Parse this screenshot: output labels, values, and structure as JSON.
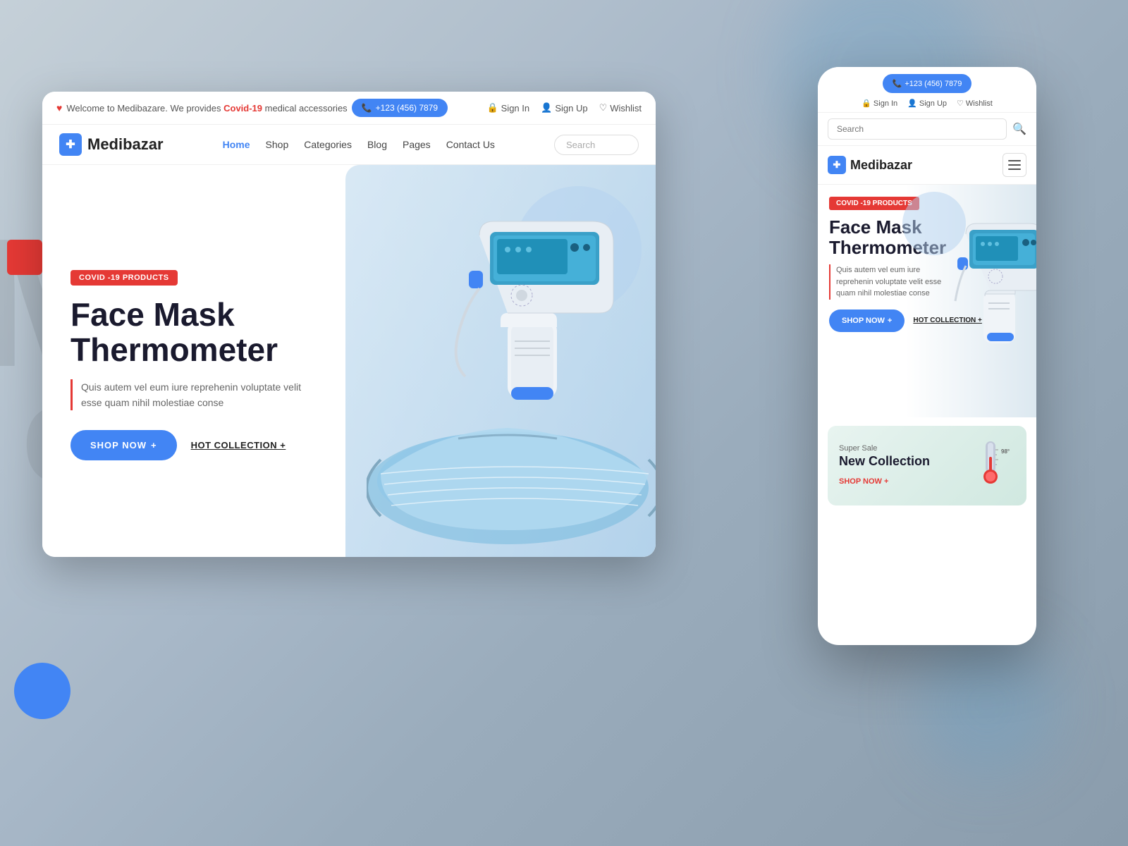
{
  "background": {
    "color": "#b0bec5"
  },
  "topbar": {
    "welcome_text": "Welcome to Medibazare. We provides ",
    "covid_link": "Covid-19",
    "welcome_suffix": " medical accessories",
    "phone": "+123 (456) 7879",
    "sign_in": "Sign In",
    "sign_up": "Sign Up",
    "wishlist": "Wishlist"
  },
  "navbar": {
    "logo_text": "Medibazar",
    "logo_icon": "✚",
    "links": [
      "Home",
      "Shop",
      "Categories",
      "Blog",
      "Pages",
      "Contact Us"
    ],
    "active_link": "Home",
    "search_placeholder": "Search"
  },
  "hero": {
    "badge": "COVID -19 PRODUCTS",
    "title_line1": "Face Mask",
    "title_line2": "Thermometer",
    "description": "Quis autem vel eum iure reprehenin voluptate velit esse quam nihil molestiae conse",
    "shop_now": "SHOP NOW",
    "hot_collection": "HOT COLLECTION +"
  },
  "mobile": {
    "phone": "+123 (456) 7879",
    "sign_in": "Sign In",
    "sign_up": "Sign Up",
    "wishlist": "Wishlist",
    "search_placeholder": "Search",
    "logo_text": "Medibazar",
    "logo_icon": "✚",
    "hero": {
      "badge": "COVID -19 PRODUCTS",
      "title_line1": "Face Mask",
      "title_line2": "Thermometer",
      "description": "Quis autem vel eum iure reprehenin voluptate velit esse quam nihil molestiae conse",
      "shop_now": "SHOP NOW",
      "hot_collection": "HOT COLLECTION +"
    },
    "sale_card": {
      "super_label": "Super Sale",
      "title": "New Collection",
      "shop_now_link": "SHOP NOW +"
    }
  },
  "colors": {
    "primary": "#4285f4",
    "danger": "#e53935",
    "dark": "#1a1a2e",
    "text": "#555555",
    "light_bg": "#dce8f0"
  }
}
